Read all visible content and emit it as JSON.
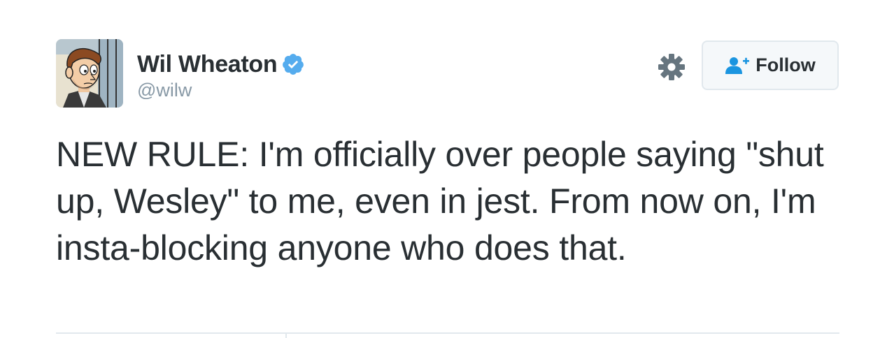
{
  "user": {
    "display_name": "Wil Wheaton",
    "handle": "@wilw",
    "verified": true,
    "avatar_icon": "cartoon-avatar"
  },
  "actions": {
    "settings_icon": "gear-icon",
    "follow_icon": "add-user-icon",
    "follow_label": "Follow"
  },
  "tweet": {
    "text": "NEW RULE: I'm officially over people saying \"shut up, Wesley\" to me, even in jest. From now on, I'm insta-blocking anyone who does that."
  },
  "colors": {
    "text": "#292f33",
    "secondary": "#8899a6",
    "verified_blue": "#55acee",
    "follow_icon_blue": "#1b95e0",
    "border": "#e1e8ed"
  }
}
